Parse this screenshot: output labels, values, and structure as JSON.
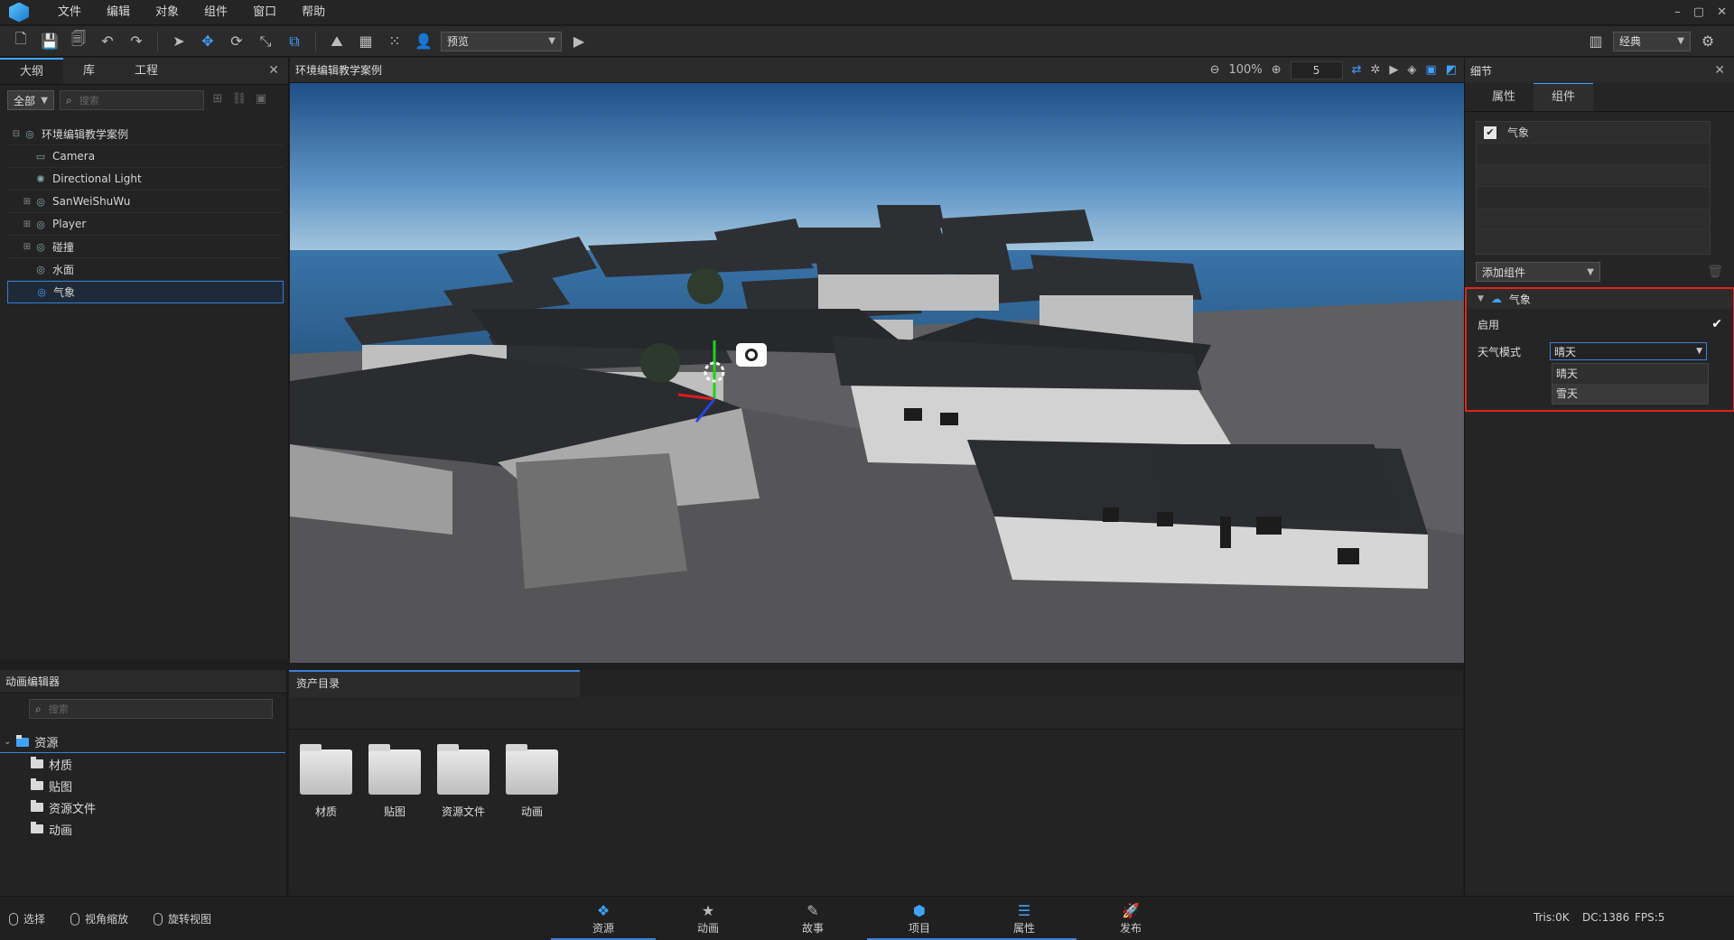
{
  "menu": [
    "文件",
    "编辑",
    "对象",
    "组件",
    "窗口",
    "帮助"
  ],
  "window_controls": [
    "–",
    "▢",
    "✕"
  ],
  "toolbar": {
    "preview_label": "预览",
    "layout_label": "经典"
  },
  "outline": {
    "tabs": [
      "大纲",
      "库",
      "工程"
    ],
    "filter": "全部",
    "search_placeholder": "搜索",
    "items": [
      {
        "label": "环境编辑教学案例",
        "icon": "group-icon"
      },
      {
        "label": "Camera",
        "icon": "camera-icon"
      },
      {
        "label": "Directional Light",
        "icon": "light-icon"
      },
      {
        "label": "SanWeiShuWu",
        "icon": "group-icon"
      },
      {
        "label": "Player",
        "icon": "group-icon"
      },
      {
        "label": "碰撞",
        "icon": "group-icon"
      },
      {
        "label": "水面",
        "icon": "group-icon"
      },
      {
        "label": "气象",
        "icon": "group-icon"
      }
    ]
  },
  "viewport": {
    "title": "环境编辑教学案例",
    "zoom": "100%",
    "speed": "5"
  },
  "detail": {
    "title": "细节",
    "tabs": [
      "属性",
      "组件"
    ],
    "components": [
      "气象"
    ],
    "add_component_label": "添加组件",
    "weather": {
      "header": "气象",
      "enable_label": "启用",
      "enable_checked": true,
      "mode_label": "天气模式",
      "mode_value": "晴天",
      "options": [
        "晴天",
        "雪天"
      ]
    }
  },
  "anim_panel": {
    "title": "动画编辑器",
    "search_placeholder": "搜索",
    "root": "资源",
    "children": [
      "材质",
      "贴图",
      "资源文件",
      "动画"
    ]
  },
  "asset_panel": {
    "tab": "资产目录",
    "folders": [
      "材质",
      "贴图",
      "资源文件",
      "动画"
    ]
  },
  "status": {
    "hints": [
      "选择",
      "视角缩放",
      "旋转视图"
    ],
    "nav": [
      {
        "label": "资源",
        "icon": "resource-icon"
      },
      {
        "label": "动画",
        "icon": "animation-icon"
      },
      {
        "label": "故事",
        "icon": "story-icon"
      },
      {
        "label": "项目",
        "icon": "project-icon"
      },
      {
        "label": "属性",
        "icon": "properties-icon"
      },
      {
        "label": "发布",
        "icon": "publish-icon"
      }
    ],
    "tris": "Tris:0K",
    "dc": "DC:1386",
    "fps": "FPS:5"
  }
}
